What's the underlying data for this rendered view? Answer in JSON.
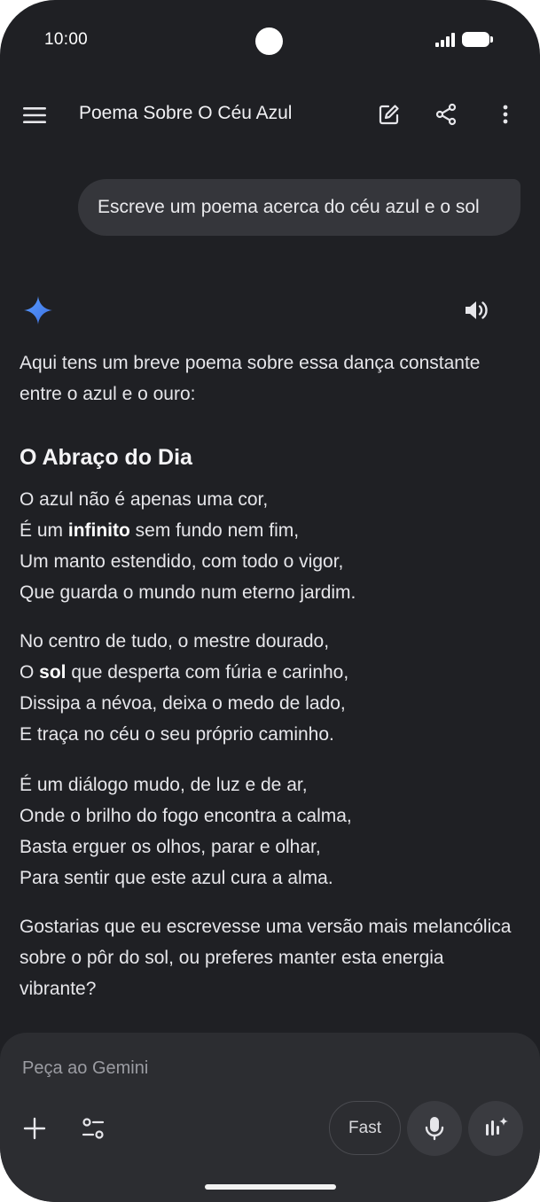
{
  "status_bar": {
    "time": "10:00"
  },
  "header": {
    "title": "Poema Sobre O Céu Azul"
  },
  "user_message": "Escreve um poema acerca do céu azul e o sol",
  "response": {
    "intro": "Aqui tens um breve poema sobre essa dança constante entre o azul e o ouro:",
    "poem_title": "O Abraço do Dia",
    "stanza1": {
      "l1": "O azul não é apenas uma cor,",
      "l2_pre": "É um ",
      "l2_bold": "infinito",
      "l2_post": " sem fundo nem fim,",
      "l3": "Um manto estendido, com todo o vigor,",
      "l4": "Que guarda o mundo num eterno jardim."
    },
    "stanza2": {
      "l1": "No centro de tudo, o mestre dourado,",
      "l2_pre": "O ",
      "l2_bold": "sol",
      "l2_post": " que desperta com fúria e carinho,",
      "l3": "Dissipa a névoa, deixa o medo de lado,",
      "l4": "E traça no céu o seu próprio caminho."
    },
    "stanza3": {
      "l1": "É um diálogo mudo, de luz e de ar,",
      "l2": "Onde o brilho do fogo encontra a calma,",
      "l3": "Basta erguer os olhos, parar e olhar,",
      "l4": "Para sentir que este azul cura a alma."
    },
    "follow_up": "Gostarias que eu escrevesse uma versão mais melancólica sobre o pôr do sol, ou preferes manter esta energia vibrante?"
  },
  "input": {
    "placeholder": "Peça ao Gemini",
    "mode_label": "Fast"
  },
  "icons": {
    "menu": "menu-icon",
    "edit": "edit-icon",
    "share": "share-icon",
    "more": "more-vert-icon",
    "sparkle": "gemini-sparkle-icon",
    "speaker": "speaker-icon",
    "add": "plus-icon",
    "tools": "tools-icon",
    "mic": "mic-icon",
    "live": "live-icon"
  },
  "colors": {
    "background": "#1f2024",
    "bubble": "#35363b",
    "input_panel": "#2c2d31",
    "sparkle_blue": "#4b8cf5"
  }
}
